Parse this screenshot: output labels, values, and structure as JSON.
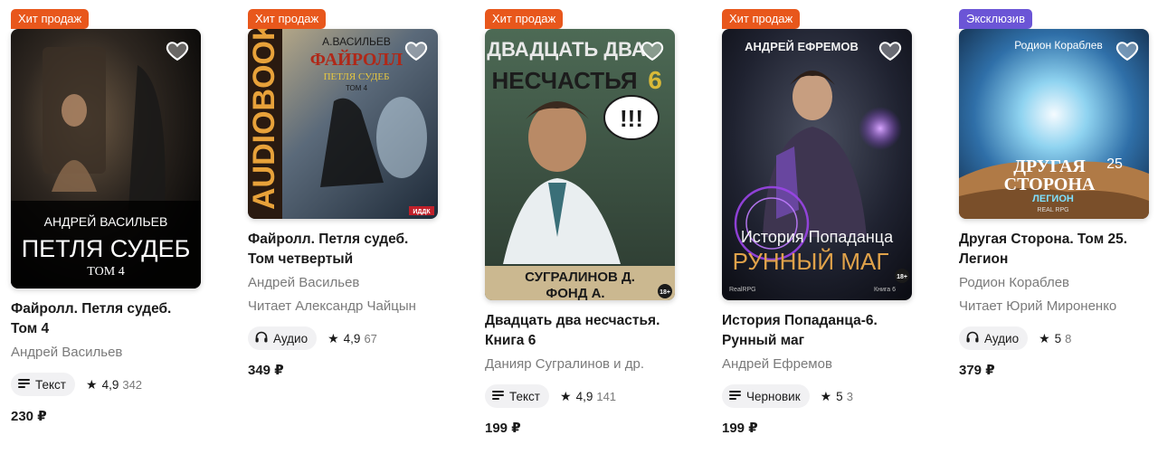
{
  "colors": {
    "hit": "#e8571c",
    "exclusive": "#6b55d6",
    "pill_bg": "#f1f1f3"
  },
  "books": [
    {
      "badge": "Хит продаж",
      "badge_type": "hit",
      "cover_texts": [
        "АНДРЕЙ ВАСИЛЬЕВ",
        "ПЕТЛЯ СУДЕБ",
        "ТОМ 4"
      ],
      "title_lines": [
        "Файролл. Петля судеб.",
        "Том 4"
      ],
      "author": "Андрей Васильев",
      "narrator": "",
      "format_label": "Текст",
      "format_icon": "text-lines-icon",
      "rating": "4,9",
      "rating_count": "342",
      "price": "230 ₽"
    },
    {
      "badge": "Хит продаж",
      "badge_type": "hit",
      "cover_texts": [
        "AUDIOBOOK",
        "А.ВАСИЛЬЕВ",
        "ФАЙРОЛЛ",
        "ПЕТЛЯ СУДЕБ",
        "ТОМ 4",
        "ИДДК"
      ],
      "title_lines": [
        "Файролл. Петля судеб.",
        "Том четвертый"
      ],
      "author": "Андрей Васильев",
      "narrator": "Читает Александр Чайцын",
      "format_label": "Аудио",
      "format_icon": "headphones-icon",
      "rating": "4,9",
      "rating_count": "67",
      "price": "349 ₽"
    },
    {
      "badge": "Хит продаж",
      "badge_type": "hit",
      "cover_texts": [
        "ДВАДЦАТЬ ДВА",
        "НЕСЧАСТЬЯ",
        "6",
        "!!!",
        "СУГРАЛИНОВ Д.",
        "ФОНД А.",
        "18+"
      ],
      "title_lines": [
        "Двадцать два несчастья.",
        "Книга 6"
      ],
      "author": "Данияр Сугралинов и др.",
      "narrator": "",
      "format_label": "Текст",
      "format_icon": "text-lines-icon",
      "rating": "4,9",
      "rating_count": "141",
      "price": "199 ₽"
    },
    {
      "badge": "Хит продаж",
      "badge_type": "hit",
      "cover_texts": [
        "АНДРЕЙ ЕФРЕМОВ",
        "История Попаданца",
        "РУННЫЙ МАГ",
        "18+",
        "RealRPG",
        "Книга 6"
      ],
      "title_lines": [
        "История Попаданца-6.",
        "Рунный маг"
      ],
      "author": "Андрей Ефремов",
      "narrator": "",
      "format_label": "Черновик",
      "format_icon": "text-lines-icon",
      "rating": "5",
      "rating_count": "3",
      "price": "199 ₽"
    },
    {
      "badge": "Эксклюзив",
      "badge_type": "exclusive",
      "cover_texts": [
        "Родион Кораблев",
        "ДРУГАЯ",
        "СТОРОНА",
        "25",
        "ЛЕГИОН",
        "REAL RPG"
      ],
      "title_lines": [
        "Другая Сторона. Том 25.",
        "Легион"
      ],
      "author": "Родион Кораблев",
      "narrator": "Читает Юрий Мироненко",
      "format_label": "Аудио",
      "format_icon": "headphones-icon",
      "rating": "5",
      "rating_count": "8",
      "price": "379 ₽"
    }
  ]
}
